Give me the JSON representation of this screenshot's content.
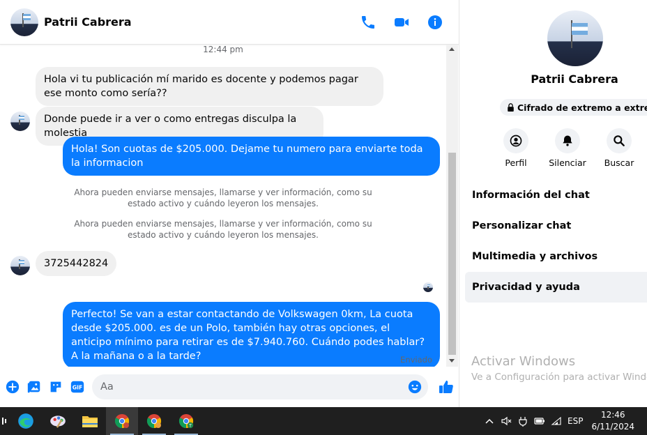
{
  "chat": {
    "contact_name": "Patrii Cabrera",
    "timestamp": "12:44 pm",
    "messages": [
      {
        "text": "Hola vi tu publicación mí marido es docente y podemos pagar ese monto como sería??"
      },
      {
        "text": "Donde puede ir a ver o como entregas disculpa la molestia"
      },
      {
        "text": "Hola! Son cuotas de $205.000. Dejame tu numero para enviarte toda la informacion"
      },
      {
        "text": "3725442824"
      },
      {
        "text": "Perfecto!  Se van a estar contactando de Volkswagen 0km, La cuota desde $205.000. es de un Polo, también hay otras opciones, el anticipo mínimo para retirar es de $7.940.760. Cuándo podes hablar? A la mañana o a la tarde?"
      }
    ],
    "system_notices": [
      "Ahora pueden enviarse mensajes, llamarse y ver información, como su estado activo y cuándo leyeron los mensajes.",
      "Ahora pueden enviarse mensajes, llamarse y ver información, como su estado activo y cuándo leyeron los mensajes."
    ],
    "sent_status": "Enviado",
    "composer_placeholder": "Aa"
  },
  "info": {
    "name": "Patrii Cabrera",
    "encryption": "Cifrado de extremo a extremo",
    "actions": [
      {
        "label": "Perfil",
        "icon": "profile-icon"
      },
      {
        "label": "Silenciar",
        "icon": "bell-icon"
      },
      {
        "label": "Buscar",
        "icon": "search-icon"
      }
    ],
    "menu": [
      {
        "label": "Información del chat"
      },
      {
        "label": "Personalizar chat"
      },
      {
        "label": "Multimedia y archivos"
      },
      {
        "label": "Privacidad y ayuda"
      }
    ]
  },
  "watermark": {
    "line1": "Activar Windows",
    "line2": "Ve a Configuración para activar Windows."
  },
  "taskbar": {
    "language": "ESP",
    "time": "12:46",
    "date": "6/11/2024"
  },
  "colors": {
    "accent": "#0a7cff",
    "incoming_bubble": "#f0f0f0",
    "taskbar": "#1f1f1f"
  }
}
